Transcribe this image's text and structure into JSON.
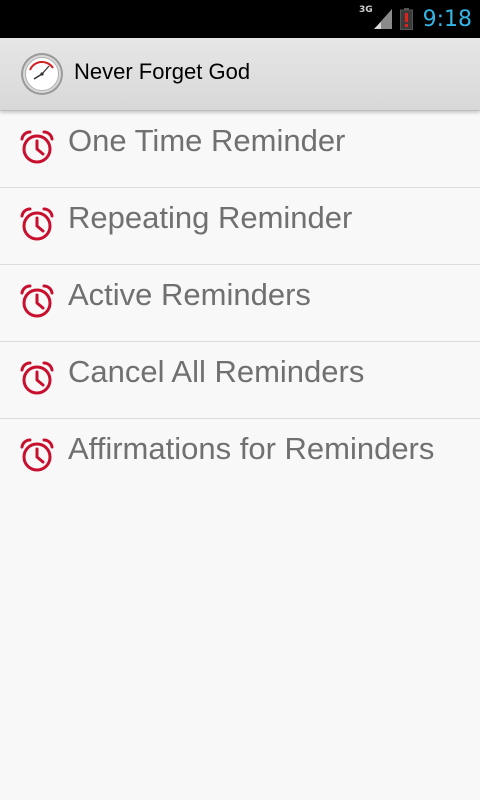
{
  "status_bar": {
    "network": "3G",
    "time": "9:18",
    "icons": [
      "signal-icon",
      "battery-alert-icon"
    ]
  },
  "action_bar": {
    "title": "Never Forget God",
    "icon": "clock-logo-icon"
  },
  "menu": {
    "items": [
      {
        "label": "One Time Reminder",
        "icon": "alarm-clock-icon"
      },
      {
        "label": "Repeating Reminder",
        "icon": "alarm-clock-icon"
      },
      {
        "label": "Active Reminders",
        "icon": "alarm-clock-icon"
      },
      {
        "label": "Cancel All Reminders",
        "icon": "alarm-clock-icon"
      },
      {
        "label": "Affirmations for Reminders",
        "icon": "alarm-clock-icon"
      }
    ]
  },
  "colors": {
    "accent_clock": "#33b5e5",
    "icon_red": "#c8102e",
    "text_gray": "#707070",
    "background": "#f8f8f8"
  }
}
